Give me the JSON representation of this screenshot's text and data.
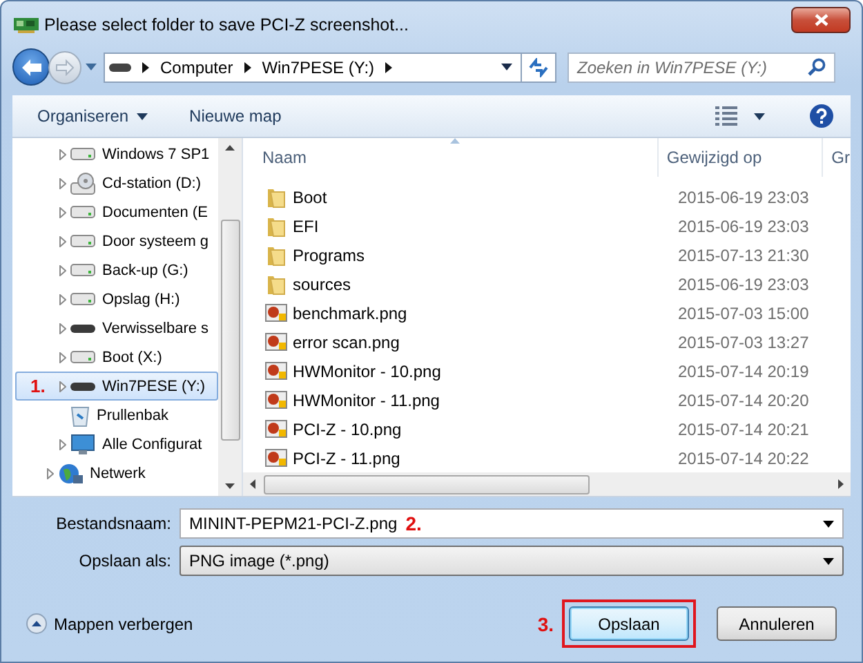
{
  "window": {
    "title": "Please select folder to save PCI-Z screenshot..."
  },
  "address_bar": {
    "path": [
      "Computer",
      "Win7PESE (Y:)"
    ]
  },
  "search": {
    "placeholder": "Zoeken in Win7PESE (Y:)"
  },
  "toolbar": {
    "organize": "Organiseren",
    "new_folder": "Nieuwe map"
  },
  "tree": [
    {
      "children": [
        {
          "kind": "drive",
          "label": "Windows 7 SP1",
          "expandable": true,
          "selected": false
        },
        {
          "kind": "cd",
          "label": "Cd-station (D:)",
          "expandable": true,
          "selected": false
        },
        {
          "kind": "drive",
          "label": "Documenten (E",
          "expandable": true,
          "selected": false
        },
        {
          "kind": "drive",
          "label": "Door systeem g",
          "expandable": true,
          "selected": false
        },
        {
          "kind": "drive",
          "label": "Back-up (G:)",
          "expandable": true,
          "selected": false
        },
        {
          "kind": "drive",
          "label": "Opslag (H:)",
          "expandable": true,
          "selected": false
        },
        {
          "kind": "removable",
          "label": "Verwisselbare s",
          "expandable": true,
          "selected": false
        },
        {
          "kind": "drive",
          "label": "Boot (X:)",
          "expandable": true,
          "selected": false
        },
        {
          "kind": "removable",
          "label": "Win7PESE (Y:)",
          "expandable": true,
          "selected": true,
          "annotation": "1."
        },
        {
          "kind": "recycle",
          "label": "Prullenbak",
          "expandable": false,
          "selected": false
        },
        {
          "kind": "config",
          "label": "Alle Configurat",
          "expandable": true,
          "selected": false
        }
      ]
    },
    {
      "kind": "network",
      "label": "Netwerk",
      "expandable": true,
      "selected": false
    }
  ],
  "columns": [
    "Naam",
    "Gewijzigd op",
    "Gr"
  ],
  "files": [
    {
      "kind": "folder",
      "name": "Boot",
      "modified": "2015-06-19 23:03"
    },
    {
      "kind": "folder",
      "name": "EFI",
      "modified": "2015-06-19 23:03"
    },
    {
      "kind": "folder",
      "name": "Programs",
      "modified": "2015-07-13 21:30"
    },
    {
      "kind": "folder",
      "name": "sources",
      "modified": "2015-06-19 23:03"
    },
    {
      "kind": "image",
      "name": "benchmark.png",
      "modified": "2015-07-03 15:00"
    },
    {
      "kind": "image",
      "name": "error scan.png",
      "modified": "2015-07-03 13:27"
    },
    {
      "kind": "image",
      "name": "HWMonitor - 10.png",
      "modified": "2015-07-14 20:19"
    },
    {
      "kind": "image",
      "name": "HWMonitor - 11.png",
      "modified": "2015-07-14 20:20"
    },
    {
      "kind": "image",
      "name": "PCI-Z - 10.png",
      "modified": "2015-07-14 20:21"
    },
    {
      "kind": "image",
      "name": "PCI-Z - 11.png",
      "modified": "2015-07-14 20:22"
    }
  ],
  "file_name": {
    "label": "Bestandsnaam:",
    "value": "MININT-PEPM21-PCI-Z.png",
    "annotation": "2."
  },
  "save_as_type": {
    "label": "Opslaan als:",
    "value": "PNG image (*.png)"
  },
  "hide_folders": "Mappen verbergen",
  "buttons": [
    {
      "label": "Opslaan",
      "default": true,
      "highlighted": true,
      "annotation": "3."
    },
    {
      "label": "Annuleren",
      "default": false,
      "highlighted": false
    }
  ]
}
